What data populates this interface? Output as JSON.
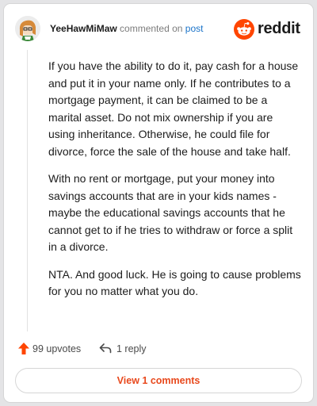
{
  "comment": {
    "username": "YeeHawMiMaw",
    "commented_text": "commented on",
    "post_link": "post",
    "paragraphs": [
      "If you have the ability to do it, pay cash for a house and put it in your name only. If he contributes to a mortgage payment, it can be claimed to be a marital asset. Do not mix ownership if you are using inheritance. Otherwise, he could file for divorce, force the sale of the house and take half.",
      "With no rent or mortgage, put your money into savings accounts that are in your kids names - maybe the educational savings accounts that he cannot get to if he tries to withdraw or force a split in a divorce.",
      "NTA. And good luck. He is going to cause problems for you no matter what you do."
    ]
  },
  "brand": {
    "name": "reddit",
    "icon": "reddit-snoo-icon",
    "color": "#ff4500"
  },
  "actions": {
    "upvotes_label": "99 upvotes",
    "upvote_icon": "upvote-arrow-icon",
    "reply_label": "1 reply",
    "reply_icon": "reply-icon"
  },
  "view_comments_label": "View 1 comments",
  "colors": {
    "accent": "#e8491d",
    "upvote": "#ff4500",
    "link": "#1a73c9"
  }
}
